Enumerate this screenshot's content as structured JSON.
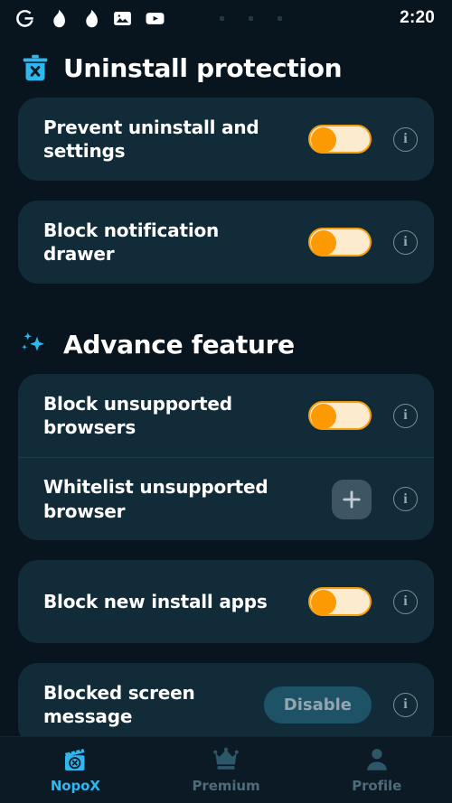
{
  "status_bar": {
    "time": "2:20",
    "icons": [
      "google-icon",
      "flame-icon",
      "flame-icon",
      "photo-icon",
      "youtube-icon"
    ],
    "dot_count": 3
  },
  "sections": [
    {
      "id": "uninstall-protection",
      "icon": "trash-x-icon",
      "title": "Uninstall protection",
      "cards": [
        {
          "rows": [
            {
              "label": "Prevent uninstall and settings",
              "control": "toggle",
              "toggle_on": true,
              "info": true
            }
          ]
        },
        {
          "rows": [
            {
              "label": "Block notification drawer",
              "control": "toggle",
              "toggle_on": true,
              "info": true
            }
          ]
        }
      ]
    },
    {
      "id": "advance-feature",
      "icon": "sparkles-icon",
      "title": "Advance feature",
      "cards": [
        {
          "rows": [
            {
              "label": "Block unsupported browsers",
              "control": "toggle",
              "toggle_on": true,
              "info": true
            },
            {
              "label": "Whitelist unsupported browser",
              "control": "plus",
              "info": true
            }
          ]
        },
        {
          "rows": [
            {
              "label": "Block new install apps",
              "control": "toggle",
              "toggle_on": true,
              "info": true
            }
          ]
        },
        {
          "rows": [
            {
              "label": "Blocked screen message",
              "control": "pill",
              "pill_label": "Disable",
              "info": true
            }
          ]
        }
      ]
    }
  ],
  "bottom_nav": [
    {
      "label": "NopoX",
      "icon": "clapperboard-x-icon",
      "active": true
    },
    {
      "label": "Premium",
      "icon": "crown-icon",
      "active": false
    },
    {
      "label": "Profile",
      "icon": "person-icon",
      "active": false
    }
  ],
  "colors": {
    "background": "#08151f",
    "card": "#122b38",
    "accent_blue": "#2eb8ef",
    "toggle_on_thumb": "#fb9a02",
    "toggle_on_track": "#fdebcf",
    "pill_background": "#1d5267",
    "nav_inactive": "#4e6b7a"
  }
}
